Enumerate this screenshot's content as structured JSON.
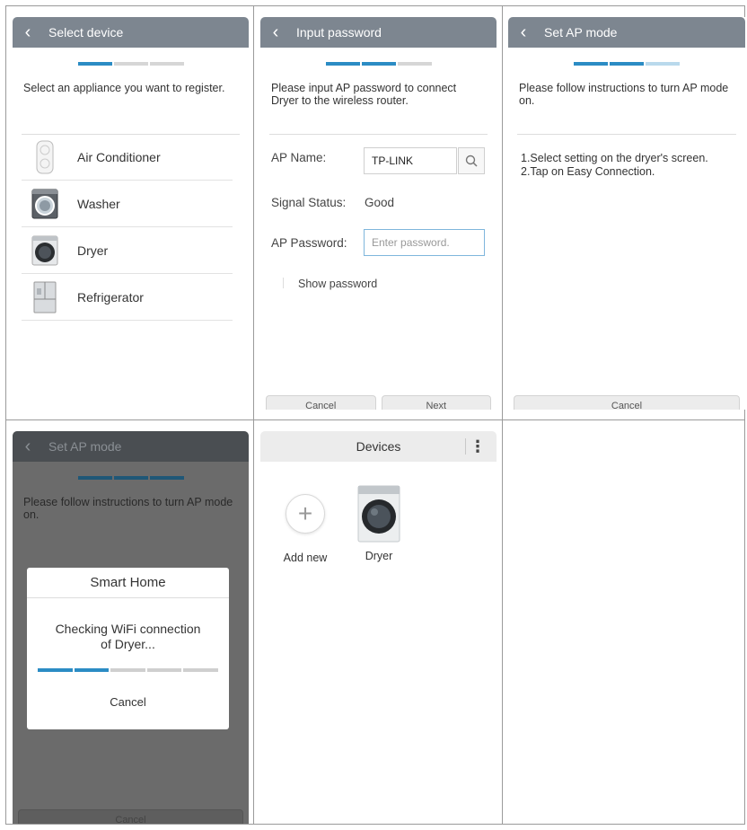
{
  "screens": {
    "select_device": {
      "title": "Select device",
      "progress": [
        1,
        0,
        0
      ],
      "lead": "Select an appliance you want to register.",
      "items": [
        {
          "label": "Air Conditioner",
          "icon": "air-conditioner-icon"
        },
        {
          "label": "Washer",
          "icon": "washer-icon"
        },
        {
          "label": "Dryer",
          "icon": "dryer-icon"
        },
        {
          "label": "Refrigerator",
          "icon": "refrigerator-icon"
        }
      ]
    },
    "input_password": {
      "title": "Input password",
      "progress": [
        1,
        1,
        0
      ],
      "lead": "Please input AP password to connect Dryer to the wireless router.",
      "ap_name_label": "AP Name:",
      "ap_name_value": "TP-LINK",
      "signal_label": "Signal Status:",
      "signal_value": "Good",
      "password_label": "AP Password:",
      "password_placeholder": "Enter password.",
      "show_password_label": "Show password",
      "buttons": [
        "Cancel",
        "Next"
      ]
    },
    "set_ap_mode": {
      "title": "Set AP mode",
      "progress": [
        1,
        1,
        0.5
      ],
      "lead": "Please follow instructions to turn AP mode on.",
      "instructions": [
        "1.Select setting on the dryer's screen.",
        "2.Tap on Easy Connection."
      ],
      "buttons": [
        "Cancel"
      ]
    },
    "checking_dialog": {
      "title": "Set AP mode",
      "lead": "Please follow instructions to turn AP mode on.",
      "dialog_title": "Smart Home",
      "dialog_message": "Checking WiFi connection of Dryer...",
      "dialog_progress": [
        1,
        1,
        0,
        0,
        0
      ],
      "dialog_cancel": "Cancel",
      "buttons": [
        "Cancel"
      ]
    },
    "devices": {
      "title": "Devices",
      "add_label": "Add new",
      "device_label": "Dryer"
    }
  },
  "colors": {
    "titlebar": "#7d8690",
    "accent": "#2b8cc4",
    "devices_bar": "#ececec",
    "overlay": "#6b6b6b"
  }
}
